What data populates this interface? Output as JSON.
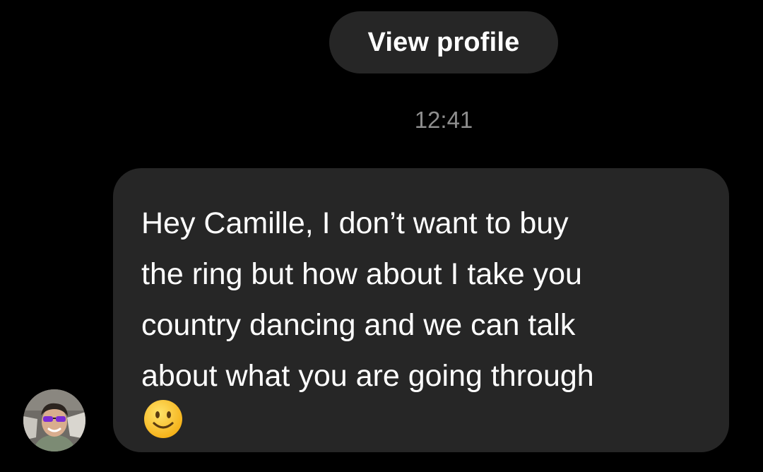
{
  "header": {
    "view_profile_label": "View profile"
  },
  "thread": {
    "timestamp": "12:41",
    "messages": [
      {
        "text": "Hey Camille, I don’t want to buy\nthe ring but how about I take you\ncountry dancing and we can talk\nabout what you are going through",
        "emoji": "slightly-smiling-face"
      }
    ]
  },
  "colors": {
    "background": "#000000",
    "bubble": "#262626",
    "text": "#ffffff",
    "timestamp": "#8e8e8e"
  }
}
